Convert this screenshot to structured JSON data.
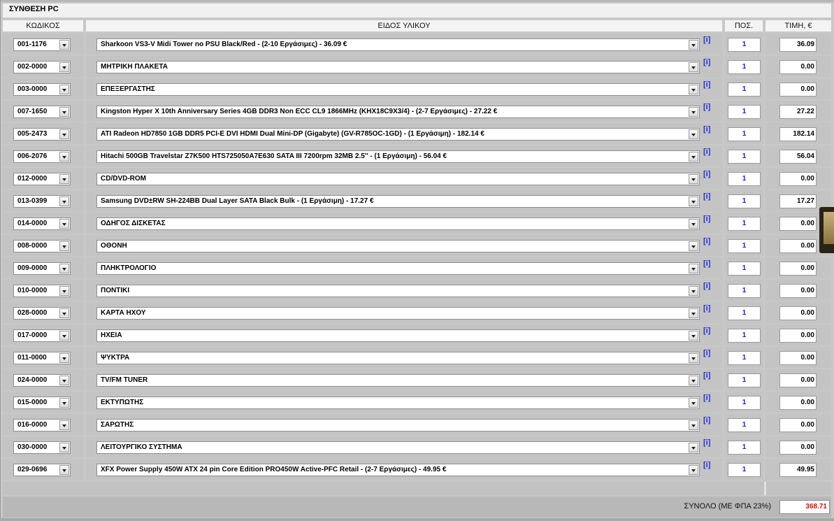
{
  "title": "ΣΥΝΘΕΣΗ PC",
  "headers": {
    "code": "ΚΩΔΙΚΟΣ",
    "item": "ΕΙΔΟΣ ΥΛΙΚΟΥ",
    "qty": "ΠΟΣ.",
    "price": "ΤΙΜΗ, €"
  },
  "info_label": "[i]",
  "rows": [
    {
      "code": "001-1176",
      "item": "Sharkoon VS3-V Midi Tower no PSU Black/Red - (2-10 Εργάσιμες) - 36.09 €",
      "qty": "1",
      "price": "36.09"
    },
    {
      "code": "002-0000",
      "item": "ΜΗΤΡΙΚΗ ΠΛΑΚΕΤΑ",
      "qty": "1",
      "price": "0.00"
    },
    {
      "code": "003-0000",
      "item": "ΕΠΕΞΕΡΓΑΣΤΗΣ",
      "qty": "1",
      "price": "0.00"
    },
    {
      "code": "007-1650",
      "item": "Kingston Hyper X 10th Anniversary Series 4GB DDR3 Non ECC CL9 1866MHz (KHX18C9X3/4) - (2-7 Εργάσιμες) - 27.22 €",
      "qty": "1",
      "price": "27.22"
    },
    {
      "code": "005-2473",
      "item": "ATI Radeon HD7850 1GB DDR5 PCI-E DVI HDMI Dual Mini-DP (Gigabyte) (GV-R785OC-1GD) - (1 Εργάσιμη) - 182.14 €",
      "qty": "1",
      "price": "182.14"
    },
    {
      "code": "006-2076",
      "item": "Hitachi 500GB Travelstar Z7K500 HTS725050A7E630 SATA III 7200rpm 32MB 2.5'' - (1 Εργάσιμη) - 56.04 €",
      "qty": "1",
      "price": "56.04"
    },
    {
      "code": "012-0000",
      "item": "CD/DVD-ROM",
      "qty": "1",
      "price": "0.00"
    },
    {
      "code": "013-0399",
      "item": "Samsung DVD±RW SH-224BB Dual Layer SATA Black Bulk - (1 Εργάσιμη) - 17.27 €",
      "qty": "1",
      "price": "17.27"
    },
    {
      "code": "014-0000",
      "item": "ΟΔΗΓΟΣ ΔΙΣΚΕΤΑΣ",
      "qty": "1",
      "price": "0.00"
    },
    {
      "code": "008-0000",
      "item": "ΟΘΟΝΗ",
      "qty": "1",
      "price": "0.00"
    },
    {
      "code": "009-0000",
      "item": "ΠΛΗΚΤΡΟΛΟΓΙΟ",
      "qty": "1",
      "price": "0.00"
    },
    {
      "code": "010-0000",
      "item": "ΠΟΝΤΙΚΙ",
      "qty": "1",
      "price": "0.00"
    },
    {
      "code": "028-0000",
      "item": "ΚΑΡΤΑ ΗΧΟΥ",
      "qty": "1",
      "price": "0.00"
    },
    {
      "code": "017-0000",
      "item": "ΗΧΕΙΑ",
      "qty": "1",
      "price": "0.00"
    },
    {
      "code": "011-0000",
      "item": "ΨΥΚΤΡΑ",
      "qty": "1",
      "price": "0.00"
    },
    {
      "code": "024-0000",
      "item": "TV/FM TUNER",
      "qty": "1",
      "price": "0.00"
    },
    {
      "code": "015-0000",
      "item": "ΕΚΤΥΠΩΤΗΣ",
      "qty": "1",
      "price": "0.00"
    },
    {
      "code": "016-0000",
      "item": "ΣΑΡΩΤΗΣ",
      "qty": "1",
      "price": "0.00"
    },
    {
      "code": "030-0000",
      "item": "ΛΕΙΤΟΥΡΓΙΚΟ ΣΥΣΤΗΜΑ",
      "qty": "1",
      "price": "0.00"
    },
    {
      "code": "029-0696",
      "item": "XFX Power Supply 450W ATX 24 pin Core Edition PRO450W Active-PFC Retail - (2-7 Εργάσιμες) - 49.95 €",
      "qty": "1",
      "price": "49.95"
    }
  ],
  "total": {
    "label": "ΣΥΝΟΛΟ (ΜΕ ΦΠΑ 23%)",
    "value": "368.71"
  },
  "colors": {
    "total_value": "#d01010",
    "qty_text": "#1a1ad0",
    "info_link": "#1e2fd6"
  }
}
